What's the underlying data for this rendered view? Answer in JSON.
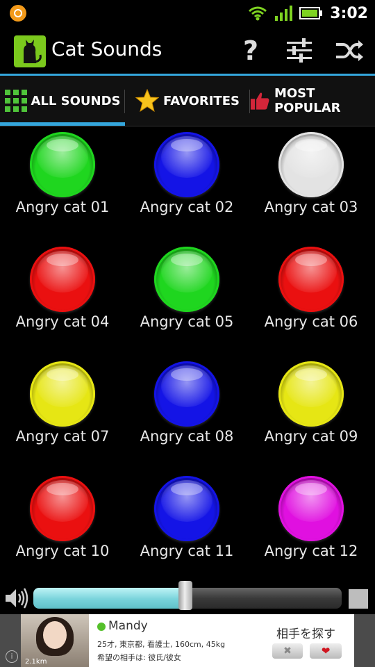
{
  "status_bar": {
    "time": "3:02",
    "icons": [
      "app-notification-icon",
      "wifi-icon",
      "signal-icon",
      "battery-icon"
    ],
    "battery_color": "#7ed321"
  },
  "action_bar": {
    "title": "Cat Sounds",
    "app_icon": "cat-icon",
    "help_label": "?",
    "actions": [
      "help-icon",
      "equalizer-icon",
      "shuffle-icon"
    ],
    "accent_color": "#34a6dc"
  },
  "tabs": [
    {
      "label": "ALL SOUNDS",
      "icon": "grid-icon",
      "selected": true
    },
    {
      "label": "FAVORITES",
      "icon": "star-icon",
      "selected": false
    },
    {
      "label": "MOST POPULAR",
      "icon": "thumbs-up-icon",
      "selected": false
    }
  ],
  "sounds": [
    {
      "label": "Angry cat 01",
      "color": "#1fd61f"
    },
    {
      "label": "Angry cat 02",
      "color": "#1414e6"
    },
    {
      "label": "Angry cat 03",
      "color": "#e3e3e3"
    },
    {
      "label": "Angry cat 04",
      "color": "#ea1010"
    },
    {
      "label": "Angry cat 05",
      "color": "#1fd61f"
    },
    {
      "label": "Angry cat 06",
      "color": "#ea1010"
    },
    {
      "label": "Angry cat 07",
      "color": "#e6e614"
    },
    {
      "label": "Angry cat 08",
      "color": "#1414e6"
    },
    {
      "label": "Angry cat 09",
      "color": "#e6e614"
    },
    {
      "label": "Angry cat 10",
      "color": "#ea1010"
    },
    {
      "label": "Angry cat 11",
      "color": "#1414e6"
    },
    {
      "label": "Angry cat 12",
      "color": "#e010e0"
    }
  ],
  "volume": {
    "level": 0.47,
    "icon": "speaker-icon",
    "stop_icon": "stop-icon"
  },
  "ad": {
    "name": "Mandy",
    "line1": "25才, 東京都, 看護士, 160cm, 45kg",
    "line2": "希望の相手は: 彼氏/彼女",
    "cta": "相手を探す",
    "no_label": "✖",
    "yes_label": "❤",
    "distance": "2.1km",
    "info_label": "i",
    "online_color": "#55c02b"
  }
}
